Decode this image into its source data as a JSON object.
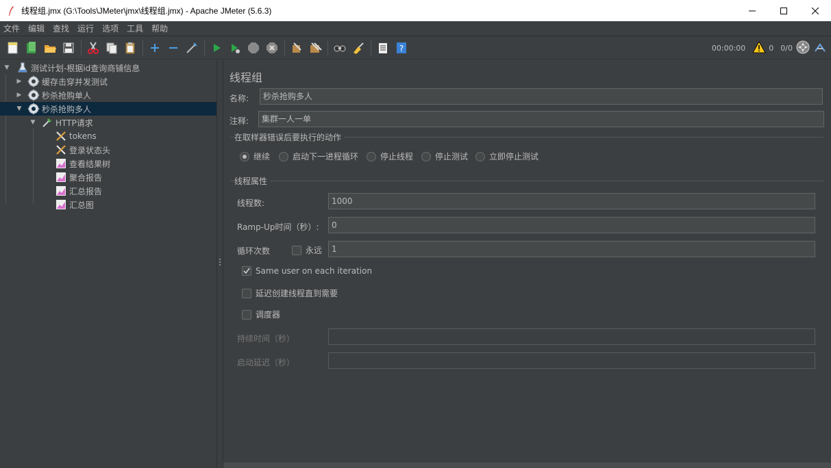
{
  "window": {
    "title": "线程组.jmx (G:\\Tools\\JMeter\\jmx\\线程组.jmx) - Apache JMeter (5.6.3)",
    "minimize": "—",
    "maximize": "☐",
    "close": "✕"
  },
  "menu": [
    "文件",
    "编辑",
    "查找",
    "运行",
    "选项",
    "工具",
    "帮助"
  ],
  "toolbar": {
    "timer": "00:00:00",
    "warnings": "0",
    "threads": "0/0"
  },
  "tree": {
    "items": [
      {
        "label": "测试计划-根据id查询商铺信息",
        "icon": "flask-icon",
        "level": 0,
        "expanded": true
      },
      {
        "label": "缓存击穿并发测试",
        "icon": "gear-icon",
        "level": 1,
        "expanded": false
      },
      {
        "label": "秒杀抢购单人",
        "icon": "gear-icon",
        "level": 1,
        "expanded": false
      },
      {
        "label": "秒杀抢购多人",
        "icon": "gear-icon",
        "level": 1,
        "expanded": true,
        "selected": true
      },
      {
        "label": "HTTP请求",
        "icon": "pipette-icon",
        "level": 2,
        "expanded": true
      },
      {
        "label": "tokens",
        "icon": "tools-icon",
        "level": 3
      },
      {
        "label": "登录状态头",
        "icon": "tools-icon",
        "level": 3
      },
      {
        "label": "查看结果树",
        "icon": "graph-icon",
        "level": 3
      },
      {
        "label": "聚合报告",
        "icon": "graph-icon",
        "level": 3
      },
      {
        "label": "汇总报告",
        "icon": "graph-icon",
        "level": 3
      },
      {
        "label": "汇总图",
        "icon": "graph-icon",
        "level": 3
      }
    ]
  },
  "panel": {
    "title": "线程组",
    "name_label": "名称:",
    "name_value": "秒杀抢购多人",
    "comment_label": "注释:",
    "comment_value": "集群一人一单",
    "error_section": "在取样器错误后要执行的动作",
    "error_actions": [
      {
        "label": "继续",
        "selected": true
      },
      {
        "label": "启动下一进程循环",
        "selected": false
      },
      {
        "label": "停止线程",
        "selected": false
      },
      {
        "label": "停止测试",
        "selected": false
      },
      {
        "label": "立即停止测试",
        "selected": false
      }
    ],
    "thread_section": "线程属性",
    "threads_label": "线程数:",
    "threads_value": "1000",
    "rampup_label": "Ramp-Up时间（秒）:",
    "rampup_value": "0",
    "loop_label": "循环次数",
    "forever_label": "永远",
    "forever_checked": false,
    "loop_value": "1",
    "same_user_label": "Same user on each iteration",
    "same_user_checked": true,
    "delay_create_label": "延迟创建线程直到需要",
    "delay_create_checked": false,
    "scheduler_label": "调度器",
    "scheduler_checked": false,
    "duration_label": "持续时间（秒）",
    "duration_value": "",
    "startup_delay_label": "启动延迟（秒）",
    "startup_delay_value": ""
  }
}
